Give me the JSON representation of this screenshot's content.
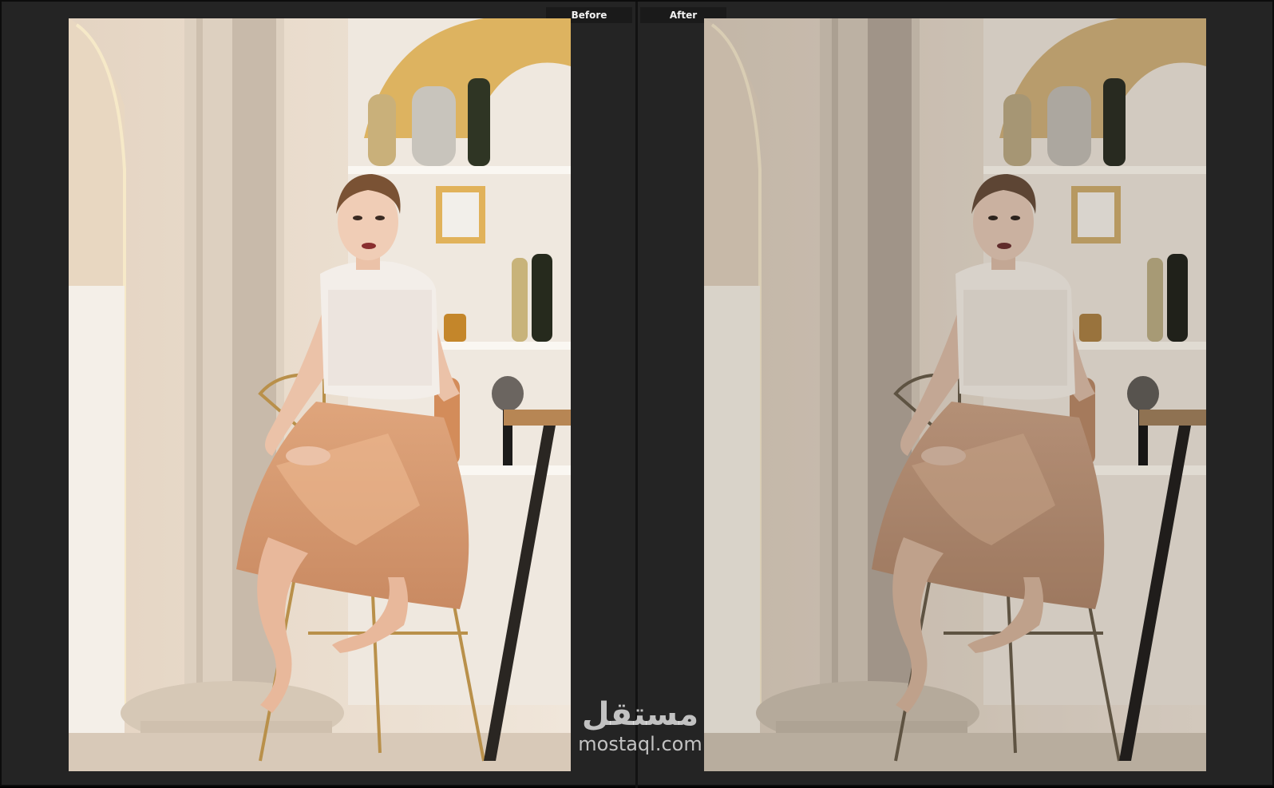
{
  "compare": {
    "before_label": "Before",
    "after_label": "After"
  },
  "photo": {
    "subject": "woman-seated-on-bar-stool",
    "colors": {
      "wall": "#e9dccd",
      "column": "#ddd0c0",
      "skirt": "#d79a72",
      "lace_top": "#f3eee9",
      "gold_arch": "#d9a94a",
      "floor": "#d8c9b8",
      "stool_leg": "#2a2622"
    }
  },
  "watermark": {
    "logo_text": "مستقل",
    "url_text": "mostaql.com"
  },
  "ui_colors": {
    "background": "#242424",
    "label_tab": "#1a1a1a",
    "label_text": "#f2f2f2"
  }
}
